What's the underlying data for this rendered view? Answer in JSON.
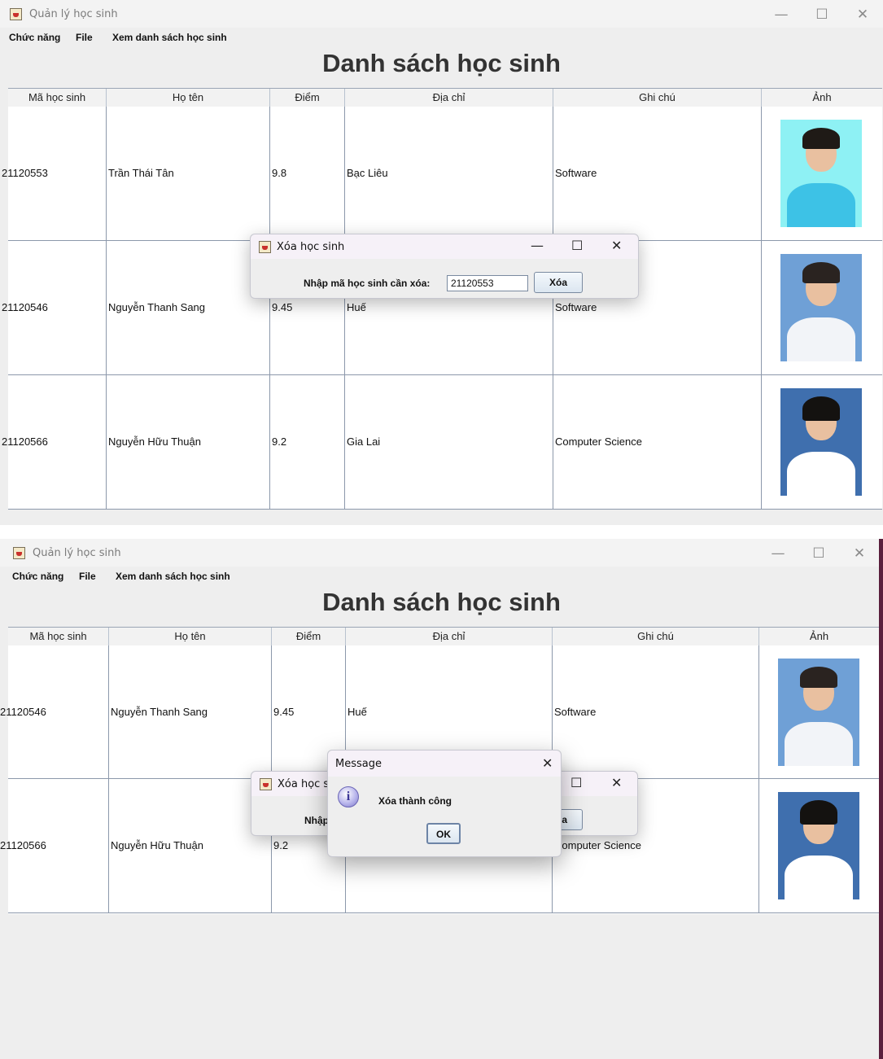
{
  "window": {
    "title": "Quản lý học sinh",
    "controls": {
      "minimize": "—",
      "maximize": "☐",
      "close": "✕"
    }
  },
  "menu": [
    "Chức năng",
    "File",
    "Xem danh sách học sinh"
  ],
  "heading": "Danh sách học sinh",
  "columns": [
    "Mã học sinh",
    "Họ tên",
    "Điểm",
    "Địa chỉ",
    "Ghi chú",
    "Ảnh"
  ],
  "screen1": {
    "rows": [
      {
        "id": "21120553",
        "name": "Trần Thái Tân",
        "score": "9.8",
        "address": "Bạc Liêu",
        "note": "Software",
        "photo": "portrait-cyan-background"
      },
      {
        "id": "21120546",
        "name": "Nguyễn Thanh Sang",
        "score": "9.45",
        "address": "Huế",
        "note": "Software",
        "photo": "portrait-blue-background"
      },
      {
        "id": "21120566",
        "name": "Nguyễn Hữu Thuận",
        "score": "9.2",
        "address": "Gia Lai",
        "note": "Computer Science",
        "photo": "portrait-dark-blue-background"
      }
    ],
    "delete_dialog": {
      "title": "Xóa học sinh",
      "label": "Nhập mã học sinh cần xóa:",
      "input_value": "21120553",
      "button": "Xóa",
      "controls": {
        "minimize": "—",
        "maximize": "☐",
        "close": "✕"
      }
    }
  },
  "screen2": {
    "rows": [
      {
        "id": "21120546",
        "name": "Nguyễn Thanh Sang",
        "score": "9.45",
        "address": "Huế",
        "note": "Software",
        "photo": "portrait-blue-background"
      },
      {
        "id": "21120566",
        "name": "Nguyễn Hữu Thuận",
        "score": "9.2",
        "address": "",
        "note": "Computer Science",
        "photo": "portrait-dark-blue-background"
      }
    ],
    "message_dialog": {
      "title": "Message",
      "icon": "info-icon",
      "text": "Xóa thành công",
      "button": "OK",
      "close": "✕"
    }
  }
}
